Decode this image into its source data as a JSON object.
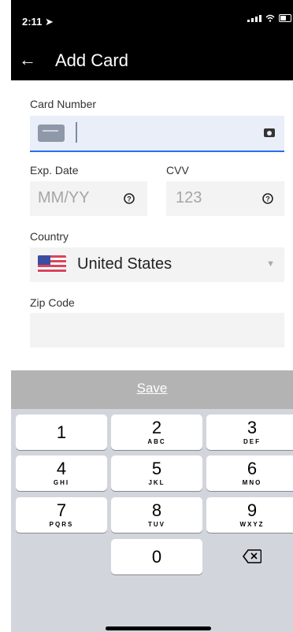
{
  "status_bar": {
    "time": "2:11",
    "location_icon": "location-arrow-icon"
  },
  "nav": {
    "title": "Add Card",
    "back_icon": "back-arrow-icon"
  },
  "form": {
    "card_number": {
      "label": "Card Number",
      "value": ""
    },
    "exp_date": {
      "label": "Exp. Date",
      "placeholder": "MM/YY"
    },
    "cvv": {
      "label": "CVV",
      "placeholder": "123"
    },
    "country": {
      "label": "Country",
      "value": "United States"
    },
    "zip": {
      "label": "Zip Code",
      "value": ""
    }
  },
  "save_label": "Save",
  "keypad": {
    "keys": [
      {
        "num": "1",
        "letters": ""
      },
      {
        "num": "2",
        "letters": "ABC"
      },
      {
        "num": "3",
        "letters": "DEF"
      },
      {
        "num": "4",
        "letters": "GHI"
      },
      {
        "num": "5",
        "letters": "JKL"
      },
      {
        "num": "6",
        "letters": "MNO"
      },
      {
        "num": "7",
        "letters": "PQRS"
      },
      {
        "num": "8",
        "letters": "TUV"
      },
      {
        "num": "9",
        "letters": "WXYZ"
      },
      {
        "num": "0",
        "letters": ""
      }
    ]
  },
  "colors": {
    "accent": "#276ef1",
    "save_bar": "#b3b3b3",
    "keyboard_bg": "#d2d5db"
  }
}
